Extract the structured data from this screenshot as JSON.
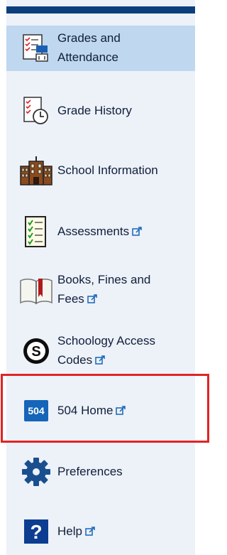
{
  "nav": {
    "items": [
      {
        "lines": [
          "Grades and",
          "Attendance"
        ],
        "external": false
      },
      {
        "lines": [
          "Grade History"
        ],
        "external": false
      },
      {
        "lines": [
          "School Information"
        ],
        "external": false
      },
      {
        "lines": [
          "Assessments"
        ],
        "external": true
      },
      {
        "lines": [
          "Books, Fines and",
          "Fees"
        ],
        "external": true
      },
      {
        "lines": [
          "Schoology Access",
          "Codes"
        ],
        "external": true
      },
      {
        "lines": [
          "504 Home"
        ],
        "external": true
      },
      {
        "lines": [
          "Preferences"
        ],
        "external": false
      },
      {
        "lines": [
          "Help"
        ],
        "external": true
      }
    ],
    "badge_504": "504"
  },
  "icons": [
    "grades-attendance-icon",
    "grade-history-icon",
    "school-building-icon",
    "assessments-checklist-icon",
    "books-icon",
    "schoology-icon",
    "badge-504-icon",
    "gear-icon",
    "help-icon",
    "external-link-icon"
  ],
  "colors": {
    "active_bg": "#bfd7ef",
    "sidebar_bg": "#edf1f8",
    "topbar": "#0a3f7c",
    "highlight_border": "#e02424",
    "icon_blue": "#1565b8"
  }
}
